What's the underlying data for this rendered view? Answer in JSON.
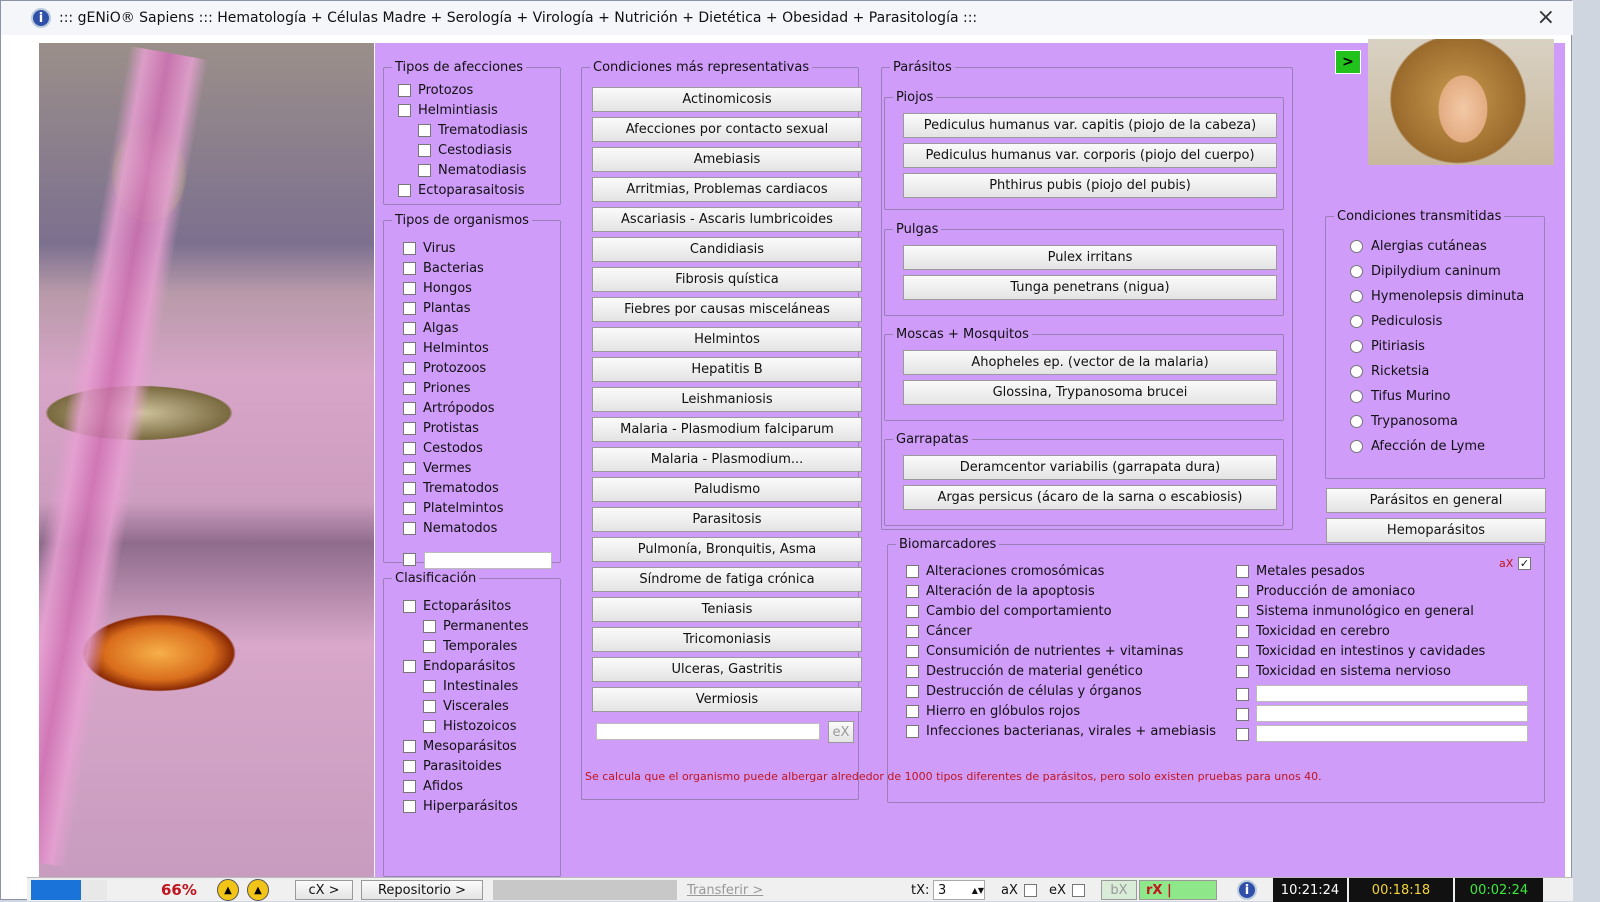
{
  "window": {
    "title": "::: gENiO® Sapiens ::: Hematología + Células Madre + Serología + Virología + Nutrición + Dietética + Obesidad + Parasitología :::",
    "close_icon": "×"
  },
  "afecciones": {
    "legend": "Tipos de afecciones",
    "items": [
      "Protozos",
      "Helmintiasis",
      "Trematodiasis",
      "Cestodiasis",
      "Nematodiasis",
      "Ectoparasaitosis"
    ]
  },
  "organismos": {
    "legend": "Tipos de organismos",
    "items": [
      "Virus",
      "Bacterias",
      "Hongos",
      "Plantas",
      "Algas",
      "Helmintos",
      "Protozoos",
      "Priones",
      "Artrópodos",
      "Protistas",
      "Cestodos",
      "Vermes",
      "Trematodos",
      "Platelmintos",
      "Nematodos"
    ]
  },
  "clasificacion": {
    "legend": "Clasificación",
    "items": [
      "Ectoparásitos",
      "Permanentes",
      "Temporales",
      "Endoparásitos",
      "Intestinales",
      "Viscerales",
      "Histozoicos",
      "Mesoparásitos",
      "Parasitoides",
      "Afidos",
      "Hiperparásitos"
    ]
  },
  "condiciones": {
    "legend": "Condiciones más representativas",
    "items": [
      "Actinomicosis",
      "Afecciones por contacto sexual",
      "Amebiasis",
      "Arritmias, Problemas cardiacos",
      "Ascariasis - Ascaris lumbricoides",
      "Candidiasis",
      "Fibrosis quística",
      "Fiebres por causas misceláneas",
      "Helmintos",
      "Hepatitis B",
      "Leishmaniosis",
      "Malaria - Plasmodium falciparum",
      "Malaria - Plasmodium...",
      "Paludismo",
      "Parasitosis",
      "Pulmonía, Bronquitis, Asma",
      "Síndrome de fatiga crónica",
      "Teniasis",
      "Tricomoniasis",
      "Ulceras, Gastritis",
      "Vermiosis"
    ],
    "ex_label": "eX"
  },
  "parasitos": {
    "legend": "Parásitos",
    "piojos": {
      "legend": "Piojos",
      "items": [
        "Pediculus humanus var. capitis (piojo de la cabeza)",
        "Pediculus humanus var. corporis (piojo del cuerpo)",
        "Phthirus pubis (piojo del pubis)"
      ]
    },
    "pulgas": {
      "legend": "Pulgas",
      "items": [
        "Pulex irritans",
        "Tunga penetrans (nigua)"
      ]
    },
    "moscas": {
      "legend": "Moscas + Mosquitos",
      "items": [
        "Ahopheles ep. (vector de la malaria)",
        "Glossina, Trypanosoma brucei"
      ]
    },
    "garrapatas": {
      "legend": "Garrapatas",
      "items": [
        "Deramcentor variabilis (garrapata dura)",
        "Argas persicus (ácaro de la sarna o escabiosis)"
      ]
    }
  },
  "transmitidas": {
    "legend": "Condiciones transmitidas",
    "items": [
      "Alergias cutáneas",
      "Dipilydium caninum",
      "Hymenolepsis diminuta",
      "Pediculosis",
      "Pitiriasis",
      "Ricketsia",
      "Tifus Murino",
      "Trypanosoma",
      "Afección de Lyme"
    ]
  },
  "side_buttons": [
    "Parásitos en general",
    "Hemoparásitos"
  ],
  "biomarcadores": {
    "legend": "Biomarcadores",
    "ax_label": "aX",
    "left": [
      "Alteraciones cromosómicas",
      "Alteración de la apoptosis",
      "Cambio del comportamiento",
      "Cáncer",
      "Consumición de nutrientes + vitaminas",
      "Destrucción de material genético",
      "Destrucción de células y órganos",
      "Hierro en glóbulos rojos",
      "Infecciones bacterianas, virales + amebiasis"
    ],
    "right": [
      "Metales pesados",
      "Producción de amoniaco",
      "Sistema inmunológico en general",
      "Toxicidad en cerebro",
      "Toxicidad en intestinos y cavidades",
      "Toxicidad en sistema nervioso"
    ]
  },
  "note": "Se calcula que el organismo puede albergar alrededor de 1000 tipos diferentes de parásitos, pero solo existen pruebas para unos 40.",
  "go_label": ">",
  "status": {
    "progress": "66%",
    "progress_fraction": 0.66,
    "cx": "cX >",
    "repositorio": "Repositorio >",
    "transferir": "Transferir >",
    "tx_label": "tX:",
    "tx_value": "3",
    "ax": "aX",
    "ex": "eX",
    "bx": "bX",
    "rx": "rX |",
    "logo": "i",
    "clock1": "10:21:24",
    "clock2": "00:18:18",
    "clock3": "00:02:24"
  }
}
